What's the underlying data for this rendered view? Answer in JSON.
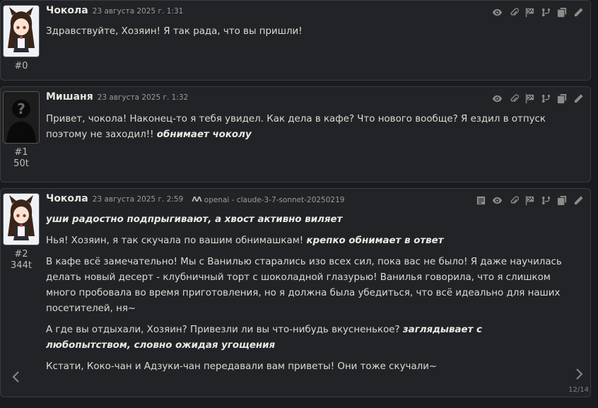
{
  "messages": [
    {
      "id_label": "#0",
      "name": "Чокола",
      "time": "23 августа 2025 г. 1:31",
      "paragraphs": [
        [
          {
            "t": "Здравствуйте, Хозяин! Я так рада, что вы пришли!",
            "i": false
          }
        ]
      ]
    },
    {
      "id_label": "#1",
      "tokens": "50t",
      "name": "Мишаня",
      "time": "23 августа 2025 г. 1:32",
      "paragraphs": [
        [
          {
            "t": "Привет, чокола! Наконец-то я тебя увидел. Как дела в кафе? Что нового вообще? Я ездил в отпуск поэтому не заходил!! ",
            "i": false
          },
          {
            "t": "обнимает чоколу",
            "i": true
          }
        ]
      ]
    },
    {
      "id_label": "#2",
      "tokens": "344t",
      "name": "Чокола",
      "time": "23 августа 2025 г. 2:59",
      "model_icon": "ΛΛ",
      "model": "openai - claude-3-7-sonnet-20250219",
      "swipe_counter": "12/14",
      "paragraphs": [
        [
          {
            "t": "уши радостно подпрыгивают, а хвост активно виляет",
            "i": true
          }
        ],
        [
          {
            "t": "Нья! Хозяин, я так скучала по вашим обнимашкам! ",
            "i": false
          },
          {
            "t": "крепко обнимает в ответ",
            "i": true
          }
        ],
        [
          {
            "t": "В кафе всё замечательно! Мы с Ванилью старались изо всех сил, пока вас не было! Я даже научилась делать новый десерт - клубничный торт с шоколадной глазурью! Ванилья говорила, что я слишком много пробовала во время приготовления, но я должна была убедиться, что всё идеально для наших посетителей, ня~",
            "i": false
          }
        ],
        [
          {
            "t": "А где вы отдыхали, Хозяин? Привезли ли вы что-нибудь вкусненькое? ",
            "i": false
          },
          {
            "t": "заглядывает с любопытством, словно ожидая угощения",
            "i": true
          }
        ],
        [
          {
            "t": "Кстати, Коко-чан и Адзуки-чан передавали вам приветы! Они тоже скучали~",
            "i": false
          }
        ]
      ]
    }
  ],
  "icons": [
    "eye-icon",
    "paperclip-icon",
    "flag-icon",
    "branch-icon",
    "copy-icon",
    "pencil-icon",
    "note-icon",
    "chevron-left-icon",
    "chevron-right-icon"
  ],
  "colors": {
    "background": "#1a1b1f",
    "message_bg": "#222327",
    "border": "#3a3b40",
    "text": "#dcdcd2"
  }
}
